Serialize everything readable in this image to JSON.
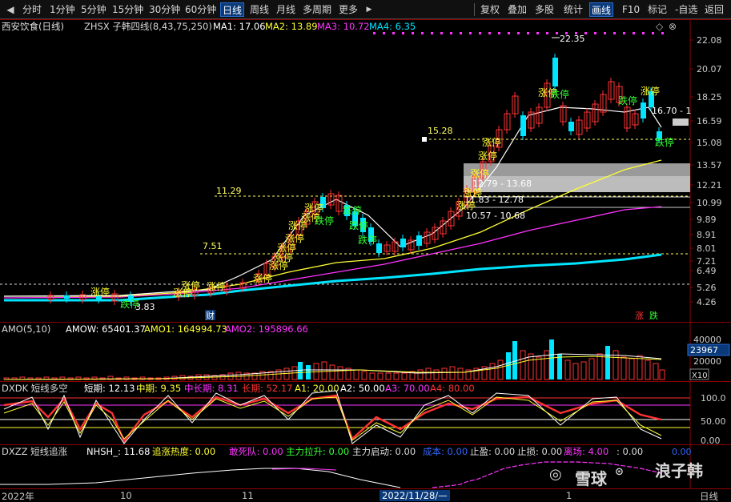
{
  "toolbar": {
    "left_items": [
      "分时",
      "1分钟",
      "5分钟",
      "15分钟",
      "30分钟",
      "60分钟",
      "日线",
      "周线",
      "月线",
      "多周期",
      "更多"
    ],
    "active": "日线",
    "right_items": [
      "复权",
      "叠加",
      "多股",
      "统计",
      "画线",
      "F10",
      "标记",
      "-自选",
      "返回"
    ]
  },
  "main_panel": {
    "stock_title": "西安饮食(日线)",
    "indicator": "ZHSX 子韩四线(8,43,75,250)",
    "ma1": "MA1: 17.06",
    "ma2": "MA2: 13.89",
    "ma3": "MA3: 10.72",
    "ma4": "MA4: 6.35",
    "price_axis": [
      "22.08",
      "20.07",
      "18.25",
      "16.59",
      "15.08",
      "13.57",
      "12.21",
      "10.99",
      "9.89",
      "8.91",
      "8.01",
      "7.21",
      "6.49",
      "5.26",
      "4.26"
    ],
    "annotations": {
      "high": "22.35",
      "low": "3.83",
      "level_1528": "15.28",
      "level_1129": "11.29",
      "level_751": "7.51",
      "range_1": "12.79 - 13.68",
      "range_2": "11.83 - 12.78",
      "range_3": "10.57 - 10.68",
      "current": "16.70 - 1"
    },
    "signals": {
      "up": "涨停",
      "down": "跌停"
    },
    "markers": {
      "cai": "财",
      "zhang": "涨",
      "die": "跌"
    }
  },
  "amo_panel": {
    "title": "AMO(5,10)",
    "amow": "AMOW: 65401.37",
    "amo1": "AMO1: 164994.73",
    "amo2": "AMO2: 195896.66",
    "axis": [
      "40000",
      "20000"
    ],
    "current_badge": "23967",
    "multiplier": "X10"
  },
  "dxdk_panel": {
    "title": "DXDK 短线多空",
    "short": "短期: 12.13",
    "mid": "中期: 9.35",
    "midlong": "中长期: 8.31",
    "long": "长期: 52.17",
    "a1": "A1: 20.00",
    "a2": "A2: 50.00",
    "a3": "A3: 70.00",
    "a4": "A4: 80.00",
    "axis": [
      "100.0",
      "50.00",
      "0.00"
    ]
  },
  "dxzz_panel": {
    "title": "DXZZ 短线追涨",
    "nhsh": "NHSH_: 11.68",
    "zzrd": "追涨热度: 0.00",
    "dsd": "敢死队: 0.00",
    "zlls": "主力拉升: 0.00",
    "zlqd": "主力启动: 0.00",
    "cost": "成本: 0.00",
    "zy": "止盈: 0.00",
    "zs": "止损: 0.00",
    "lc": "离场: 4.00",
    "end": ": 0.00",
    "axis": "0.00"
  },
  "time_axis": {
    "labels": [
      "2022年",
      "10",
      "11",
      "2022/11/28/—",
      "1"
    ],
    "period": "日线"
  },
  "watermark": {
    "brand": "雪球",
    "author": "浪子韩"
  },
  "colors": {
    "up": "#ff3232",
    "down": "#00e5ff",
    "ma1": "#ffffff",
    "ma2": "#ffff33",
    "ma3": "#ff33ff",
    "ma4": "#00e5ff",
    "border": "#8b0000"
  }
}
